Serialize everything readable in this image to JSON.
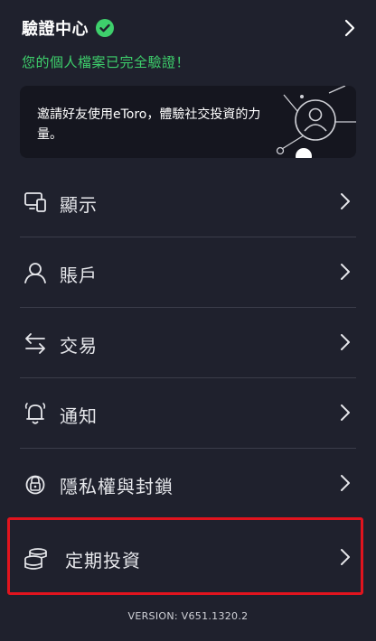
{
  "verification": {
    "title": "驗證中心",
    "status": "您的個人檔案已完全驗證！"
  },
  "invite_card": {
    "text": "邀請好友使用eToro，體驗社交投資的力量。"
  },
  "menu": {
    "items": [
      {
        "label": "顯示",
        "icon": "display-icon"
      },
      {
        "label": "賬戶",
        "icon": "user-icon"
      },
      {
        "label": "交易",
        "icon": "transfer-arrows-icon"
      },
      {
        "label": "通知",
        "icon": "bell-icon"
      },
      {
        "label": "隱私權與封鎖",
        "icon": "lock-icon"
      },
      {
        "label": "定期投資",
        "icon": "coins-icon"
      }
    ]
  },
  "version": "VERSION: V651.1320.2",
  "colors": {
    "background": "#1f212d",
    "accent_green": "#3ed06c",
    "highlight_red": "#e0141e"
  }
}
